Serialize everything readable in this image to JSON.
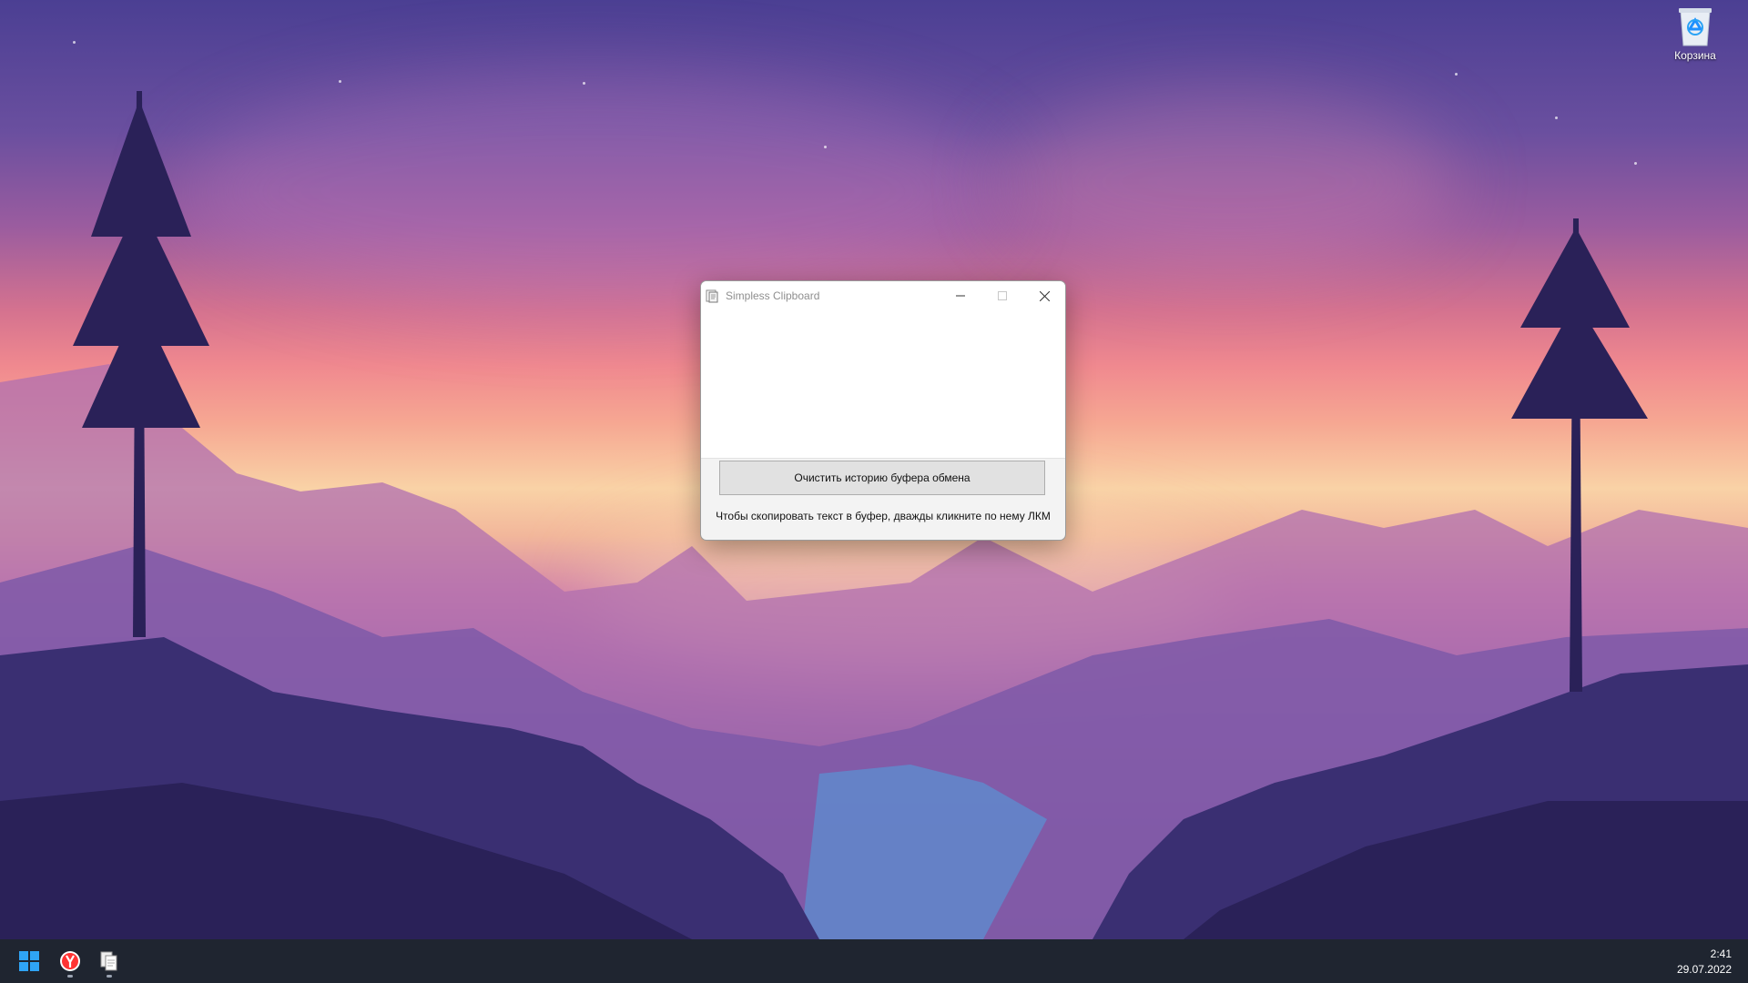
{
  "desktop": {
    "icons": [
      {
        "name": "recycle-bin",
        "label": "Корзина",
        "icon": "recycle-bin-icon"
      }
    ]
  },
  "window": {
    "title": "Simpless Clipboard",
    "app_icon": "clipboard-icon",
    "clear_button_label": "Очистить историю буфера обмена",
    "hint": "Чтобы скопировать текст в буфер, дважды кликните по нему ЛКМ",
    "history_items": []
  },
  "taskbar": {
    "items": [
      {
        "name": "start",
        "icon": "windows-logo-icon"
      },
      {
        "name": "yandex-browser",
        "icon": "yandex-browser-icon"
      },
      {
        "name": "simpless-clipboard",
        "icon": "clipboard-icon"
      }
    ],
    "clock": {
      "time": "2:41",
      "date": "29.07.2022"
    }
  },
  "colors": {
    "taskbar": "#1f2530",
    "window_bg": "#f3f3f3",
    "button_bg": "#e1e1e1",
    "accent_blue": "#1e90ff"
  }
}
